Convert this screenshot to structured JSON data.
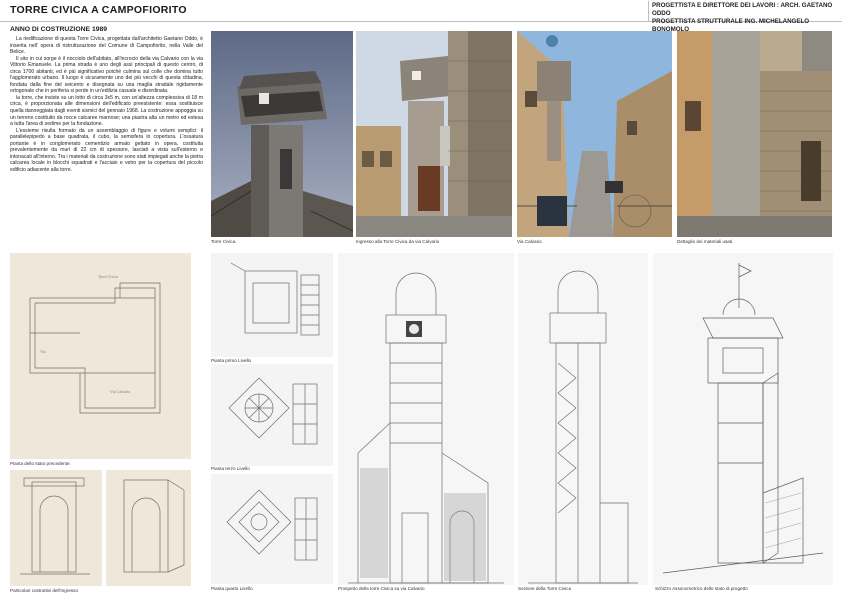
{
  "header": {
    "title": "TORRE CIVICA A CAMPOFIORITO",
    "credits": [
      "PROGETTISTA E DIRETTORE DEI LAVORI : ARCH. GAETANO ODDO",
      "PROGETTISTA STRUTTURALE ING. MICHELANGELO BONOMOLO"
    ]
  },
  "intro": {
    "year": "ANNO DI COSTRUZIONE 1989",
    "paragraphs": [
      "La riedificazione di questa Torre Civica, progettata dall'architetto Gaetano Oddo, è inserita nell' opera di ristrutturazione del Comune di Campofiorito, nella Valle del Belice.",
      "Il sito in cui sorge è il nocciolo dell'abitato, all'incrocio della via Calvario con la via Vittorio Emanuele. La prima strada è uno degli assi principali di questo centro, di circa 1700 abitanti, ed è più significativo poiché culmina sul colle che domina tutto l'agglomerato urbano. Il luogo è sicuramente uno dei più vecchi di questa cittadina, fondata dalla fine del seicento e disegnata su una maglia stradale rigidamente ortogonale che in periferia si perde in un'edilizia casuale e disordinata.",
      "la torre, che insiste su un lotto di circa 3x5 m, con un'altezza complessiva di 18 m circa, è proporzionata alle dimensioni dell'edificato preesistente: essa sostituisce quella danneggiata dagli eventi sismici del gennaio 1968. La costruzione appoggia su un terreno costituito da rocce calcaree marnose; una piastra alta un metro ed estesa a tutta l'area di sedime per la fondazione.",
      "L'essieme risulta formato da un assemblaggio di figure e volumi semplici: il parallelepipedo a base quadrata, il cubo, la semisfera in copertura. L'ossatura portante è in conglomerato cementizio armato gettato in opera, costituita prevalentemente da muri di 22 cm di spessore, lasciati a vista sull'esterno e intonacati all'interno. Tra i materiali da costruzione sono stati impiegati anche la pietra calcarea locale in blocchi squadrati e l'acciaio e vetro per la copertura del piccolo edificio adiacente alla torre."
    ]
  },
  "photos": [
    {
      "caption": "Torre Civica."
    },
    {
      "caption": "Ingresso alla Torre Civica da via Calvario"
    },
    {
      "caption": "Via Calvario"
    },
    {
      "caption": "Dettaglio dei materiali usati."
    }
  ],
  "drawings": {
    "plan_previous": {
      "caption": "Pianta dello stato precedente."
    },
    "plan_first": {
      "caption": "Pianta primo Livello"
    },
    "plan_third": {
      "caption": "Pianta terzo Livello"
    },
    "plan_fourth": {
      "caption": "Pianta quarto Livello"
    },
    "entrance_detail": {
      "caption": "Particolari costruttivi dell'Ingresso"
    },
    "elevation": {
      "caption": "Prospetto della torre Civica su via Calvario"
    },
    "section": {
      "caption": "Sezione della Torre Civica"
    },
    "axonometric": {
      "caption": "Schizzo Assonometrico dello stato di progetto"
    }
  }
}
